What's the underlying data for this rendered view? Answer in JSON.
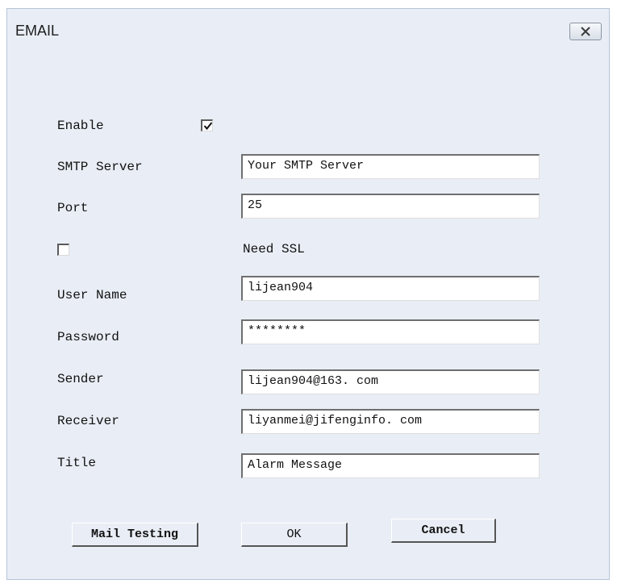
{
  "window": {
    "title": "EMAIL",
    "close_icon": "close-x-icon"
  },
  "form": {
    "enable": {
      "label": "Enable",
      "checked": true
    },
    "smtp_server": {
      "label": "SMTP Server",
      "value": "Your SMTP Server"
    },
    "port": {
      "label": "Port",
      "value": "25"
    },
    "ssl": {
      "label": "Need SSL",
      "checked": false
    },
    "user_name": {
      "label": "User Name",
      "value": "lijean904"
    },
    "password": {
      "label": "Password",
      "value": "********"
    },
    "sender": {
      "label": "Sender",
      "value": "lijean904@163. com"
    },
    "receiver": {
      "label": "Receiver",
      "value": "liyanmei@jifenginfo. com"
    },
    "title": {
      "label": "Title",
      "value": "Alarm Message"
    }
  },
  "buttons": {
    "mail_testing": "Mail Testing",
    "ok": "OK",
    "cancel": "Cancel"
  },
  "colors": {
    "dialog_bg": "#e9eef6",
    "border": "#b7c4d8"
  }
}
